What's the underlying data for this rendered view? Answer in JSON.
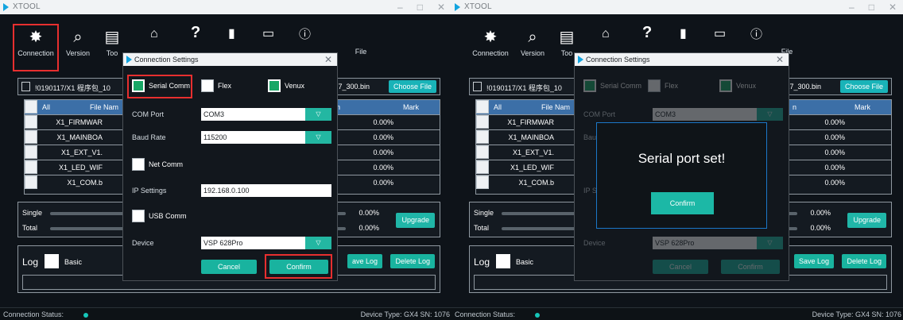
{
  "app": {
    "title": "XTOOL"
  },
  "window_controls": [
    "–",
    "□",
    "✕"
  ],
  "toolbar": {
    "connection": "Connection",
    "version": "Version",
    "tools": "Too",
    "file": "File"
  },
  "file_path": {
    "path_left": "!0190117/X1 程序包_10",
    "path_right": "!0190117/X1 程序包_10",
    "bin_label": "17_300.bin",
    "choose_file": "Choose File"
  },
  "table": {
    "headers": {
      "all": "All",
      "file_name": "File Nam",
      "n": "n",
      "mark": "Mark"
    },
    "rows": [
      {
        "name": "X1_FIRMWAR",
        "pct": "0.00%"
      },
      {
        "name": "X1_MAINBOA",
        "pct": "0.00%"
      },
      {
        "name": "X1_EXT_V1.",
        "pct": "0.00%"
      },
      {
        "name": "X1_LED_WIF",
        "pct": "0.00%"
      },
      {
        "name": "X1_COM.b",
        "pct": "0.00%"
      }
    ]
  },
  "progress": {
    "single": "Single",
    "total": "Total",
    "single_pct": "0.00%",
    "total_pct": "0.00%",
    "upgrade": "Upgrade"
  },
  "log": {
    "title": "Log",
    "basic": "Basic",
    "save_log": "ave Log",
    "save_log_right": "Save Log",
    "delete_log": "Delete Log"
  },
  "status": {
    "label": "Connection Status:",
    "device_info": "Device Type: GX4 SN: 1076",
    "dot_color": "#16c6b9"
  },
  "dialog": {
    "title": "Connection Settings",
    "options": {
      "serial": "Serial Comm",
      "flex": "Flex",
      "venux": "Venux",
      "net": "Net Comm",
      "usb": "USB Comm"
    },
    "labels": {
      "com_port": "COM Port",
      "baud_rate": "Baud Rate",
      "ip_settings": "IP Settings",
      "device": "Device"
    },
    "values": {
      "com_port": "COM3",
      "baud_rate": "115200",
      "ip_settings": "192.168.0.100",
      "device": "VSP 628Pro"
    },
    "buttons": {
      "cancel": "Cancel",
      "confirm": "Confirm"
    },
    "close": "✕",
    "dropdown_glyph": "▽",
    "dim_labels": {
      "baud": "Bau",
      "ip": "IP S"
    }
  },
  "message_box": {
    "text": "Serial port set!",
    "confirm": "Confirm"
  },
  "colors": {
    "accent_teal": "#19b3b8",
    "highlight_red": "#e72f2f",
    "table_header": "#3c6fa7",
    "check_green": "#18a766"
  }
}
